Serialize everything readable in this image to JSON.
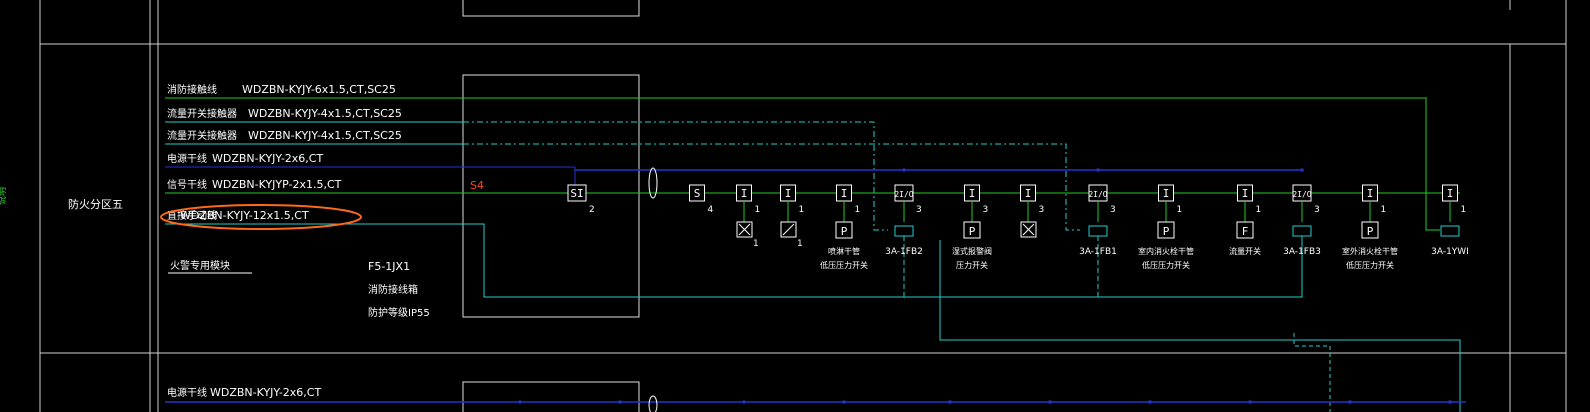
{
  "zone": {
    "left_label": "防火分区五",
    "edge_label": "说明"
  },
  "cables": [
    {
      "name": "消防接触线",
      "spec": "WDZBN-KYJY-6x1.5,CT,SC25",
      "color": "#22cc22"
    },
    {
      "name": "流量开关接触器",
      "spec": "WDZBN-KYJY-4x1.5,CT,SC25",
      "color": "#22cccc"
    },
    {
      "name": "流量开关接触器",
      "spec": "WDZBN-KYJY-4x1.5,CT,SC25",
      "color": "#22cccc"
    },
    {
      "name": "电源干线",
      "spec": "WDZBN-KYJY-2x6,CT",
      "color": "#2233cc"
    },
    {
      "name": "信号干线",
      "spec": "WDZBN-KYJYP-2x1.5,CT",
      "color": "#22cc22"
    },
    {
      "name": "直接手动线",
      "spec": "WDZBN-KYJY-12x1.5,CT",
      "color": "#22cccc"
    }
  ],
  "module": {
    "dedicated_label": "火警专用模块",
    "cabinet_id": "F5-1JX1",
    "cabinet_name": "消防接线箱",
    "protection": "防护等级IP55"
  },
  "loop_label": "S4",
  "bottom": {
    "cable_name": "电源干线",
    "cable_spec": "WDZBN-KYJY-2x6,CT"
  },
  "devices": [
    {
      "sym": "SI",
      "count": "2",
      "below": "",
      "below_count": "",
      "caption": []
    },
    {
      "sym": "S",
      "count": "4",
      "below": "",
      "below_count": "",
      "caption": []
    },
    {
      "sym": "I",
      "count": "1",
      "below": "valve",
      "below_count": "1",
      "caption": []
    },
    {
      "sym": "I",
      "count": "1",
      "below": "damper",
      "below_count": "1",
      "caption": []
    },
    {
      "sym": "I",
      "count": "1",
      "below": "P",
      "below_count": "",
      "caption": [
        "喷淋干管",
        "低压压力开关"
      ]
    },
    {
      "sym": "2I/O",
      "count": "3",
      "below": "box",
      "below_count": "",
      "caption": [
        "3A-1FB2"
      ]
    },
    {
      "sym": "I",
      "count": "3",
      "below": "P",
      "below_count": "",
      "caption": [
        "湿式报警阀",
        "压力开关"
      ]
    },
    {
      "sym": "I",
      "count": "3",
      "below": "valve",
      "below_count": "",
      "caption": []
    },
    {
      "sym": "2I/O",
      "count": "3",
      "below": "box",
      "below_count": "",
      "caption": [
        "3A-1FB1"
      ]
    },
    {
      "sym": "I",
      "count": "1",
      "below": "P",
      "below_count": "",
      "caption": [
        "室内消火栓干管",
        "低压压力开关"
      ]
    },
    {
      "sym": "I",
      "count": "1",
      "below": "F",
      "below_count": "",
      "caption": [
        "流量开关"
      ]
    },
    {
      "sym": "2I/O",
      "count": "3",
      "below": "box",
      "below_count": "",
      "caption": [
        "3A-1FB3"
      ]
    },
    {
      "sym": "I",
      "count": "1",
      "below": "P",
      "below_count": "",
      "caption": [
        "室外消火栓干管",
        "低压压力开关"
      ]
    },
    {
      "sym": "I",
      "count": "1",
      "below": "box",
      "below_count": "",
      "caption": [
        "3A-1YWI"
      ]
    }
  ]
}
